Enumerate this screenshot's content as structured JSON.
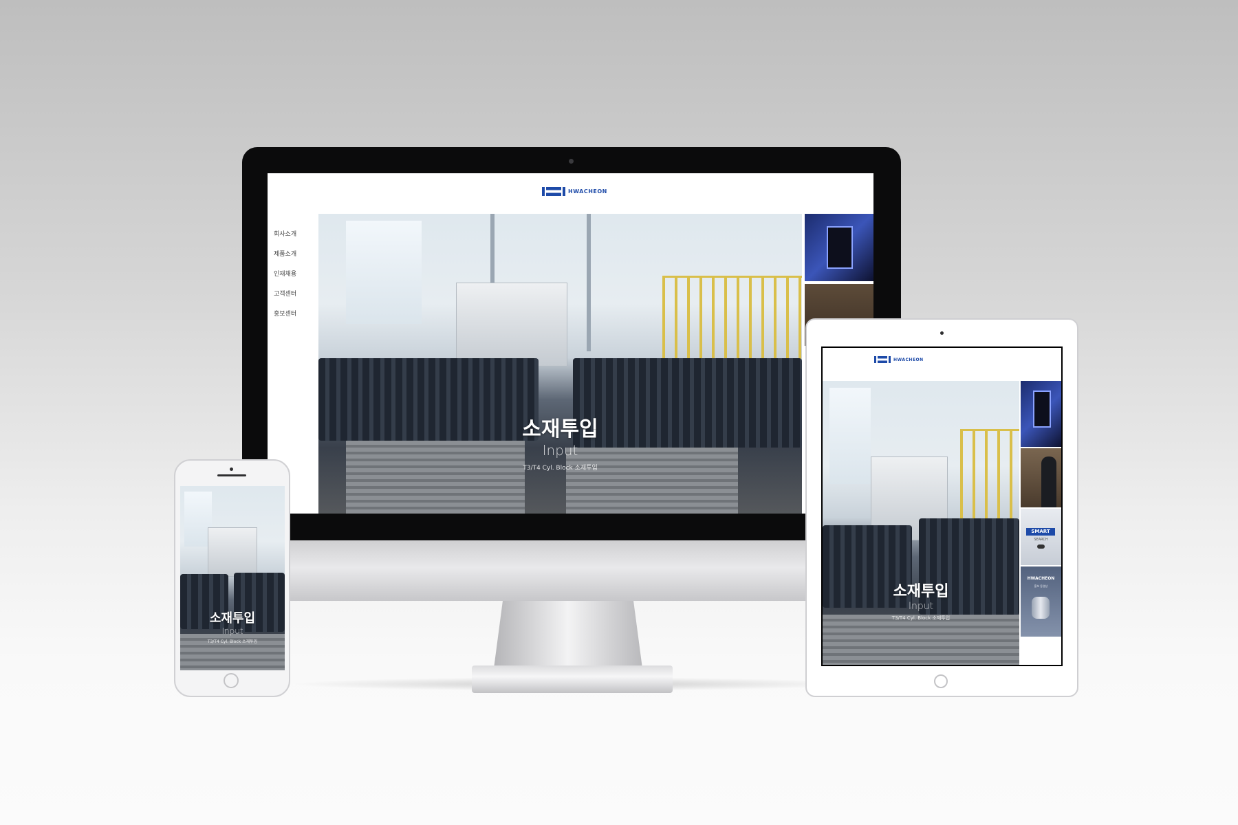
{
  "site": {
    "logo_text": "HWACHEON",
    "brand_color": "#1d4aa8",
    "nav": [
      "회사소개",
      "제품소개",
      "인재채용",
      "고객센터",
      "홍보센터"
    ]
  },
  "hero": {
    "title": "소재투입",
    "subtitle": "Input",
    "description": "T3/T4 Cyl. Block 소재투입"
  },
  "side_panels": {
    "smart": {
      "label": "SMART",
      "sub": "SEARCH"
    },
    "brand": {
      "label": "HWACHEON",
      "sub": "홍보 동영상"
    }
  },
  "devices": {
    "monitor_icon": "webcam-icon",
    "phone_icon": "home-button-icon",
    "tablet_icon": "home-button-icon"
  }
}
